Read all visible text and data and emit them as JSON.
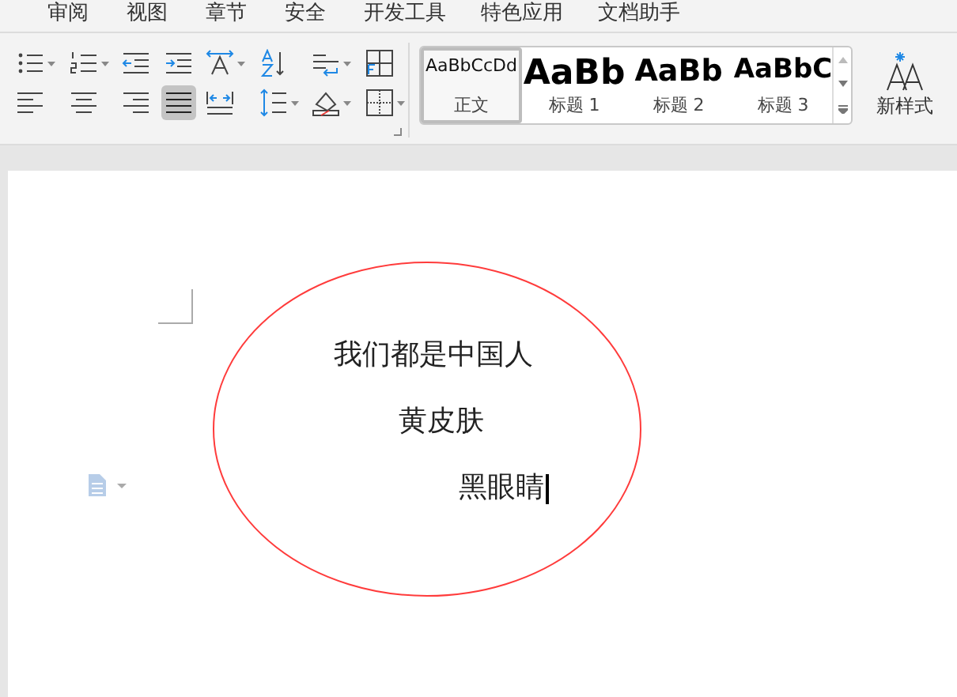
{
  "menu_tabs": [
    {
      "label": "审阅",
      "selected": false
    },
    {
      "label": "视图",
      "selected": false
    },
    {
      "label": "章节",
      "selected": false
    },
    {
      "label": "安全",
      "selected": false
    },
    {
      "label": "开发工具",
      "selected": false
    },
    {
      "label": "特色应用",
      "selected": false
    },
    {
      "label": "文档助手",
      "selected": false
    }
  ],
  "paragraph_tools": [
    {
      "kind": "bullets",
      "selected": false
    },
    {
      "kind": "numbering",
      "selected": false
    },
    {
      "kind": "outdent",
      "selected": false
    },
    {
      "kind": "indent",
      "selected": false
    },
    {
      "kind": "text-direction",
      "selected": false
    },
    {
      "kind": "sort",
      "selected": false
    },
    {
      "kind": "paragraph-marks",
      "selected": false
    },
    {
      "kind": "table-layout",
      "selected": false
    },
    {
      "kind": "align-left",
      "selected": false
    },
    {
      "kind": "align-center",
      "selected": false
    },
    {
      "kind": "align-right",
      "selected": false
    },
    {
      "kind": "justify",
      "selected": true
    },
    {
      "kind": "distribute",
      "selected": false
    },
    {
      "kind": "line-spacing",
      "selected": false
    },
    {
      "kind": "shading",
      "selected": false
    },
    {
      "kind": "borders",
      "selected": false
    }
  ],
  "styles": [
    {
      "preview": "AaBbCcDd",
      "label": "正文",
      "selected": true
    },
    {
      "preview": "AaBb",
      "label": "标题 1",
      "selected": false
    },
    {
      "preview": "AaBb",
      "label": "标题 2",
      "selected": false
    },
    {
      "preview": "AaBbC",
      "label": "标题 3",
      "selected": false
    }
  ],
  "new_style": "新样式",
  "document_lines": [
    {
      "text": "我们都是中国人",
      "cursor": false
    },
    {
      "text": "黄皮肤",
      "cursor": false
    },
    {
      "text": "黑眼睛",
      "cursor": true
    }
  ]
}
